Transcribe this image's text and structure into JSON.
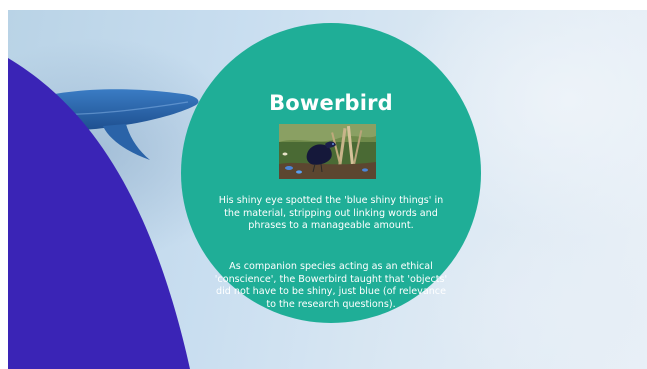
{
  "slide": {
    "title": "Bowerbird",
    "paragraph_1": "His shiny eye spotted the 'blue shiny things' in the material, stripping out linking words and phrases to a manageable amount.",
    "paragraph_2": "As companion species acting as an ethical 'conscience', the Bowerbird taught that  'objects' did not have to be shiny, just blue (of relevance to the research questions)."
  },
  "colors": {
    "circle": "#1fae97",
    "purple_shape": "#3a24b6",
    "whale": "#2f6eb8",
    "background": "#c9def0",
    "text": "#ffffff"
  },
  "images": {
    "photo": "bowerbird-photo",
    "background": "blue-whale-underwater"
  }
}
